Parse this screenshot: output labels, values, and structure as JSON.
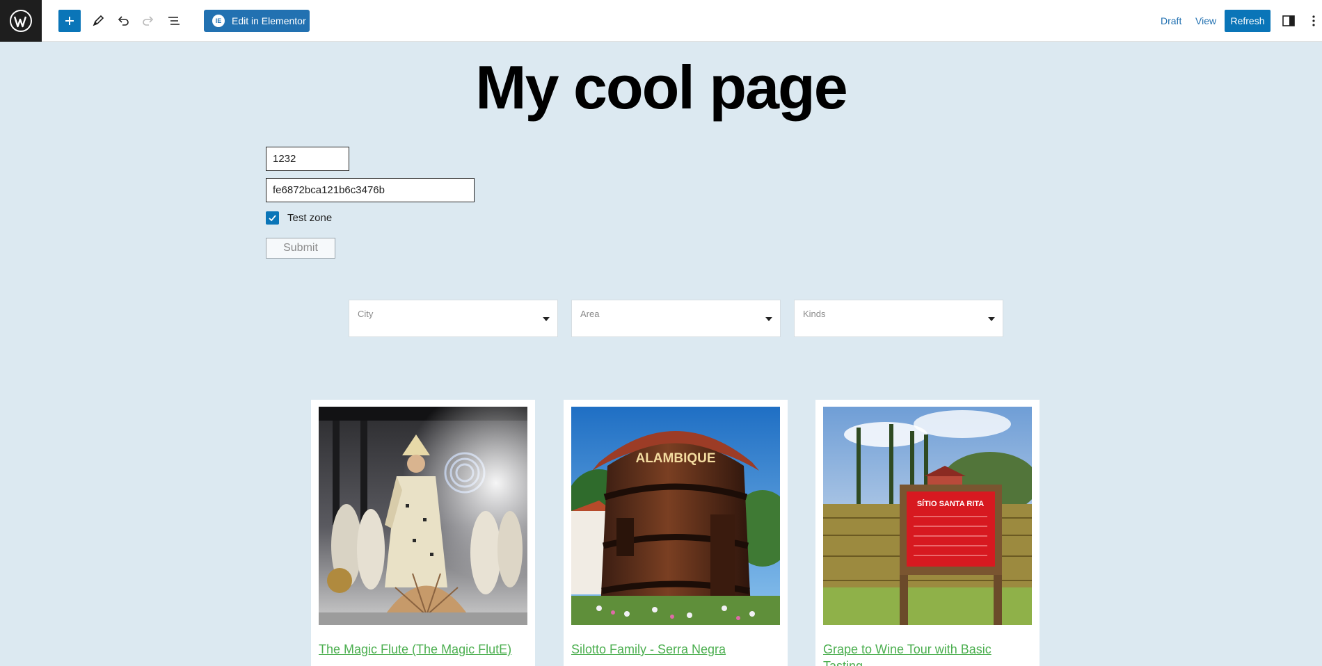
{
  "toolbar": {
    "elementor_label": "Edit in Elementor",
    "draft_label": "Draft",
    "view_label": "View",
    "refresh_label": "Refresh"
  },
  "page": {
    "title": "My cool page"
  },
  "form": {
    "id_value": "1232",
    "key_value": "fe6872bca121b6c3476b",
    "checkbox_label": "Test zone",
    "checkbox_checked": true,
    "submit_label": "Submit"
  },
  "filters": {
    "city_label": "City",
    "area_label": "Area",
    "kinds_label": "Kinds"
  },
  "cards": [
    {
      "title": "The Magic Flute (The Magic FlutE)"
    },
    {
      "title": "Silotto Family - Serra Negra",
      "sign_text": "ALAMBIQUE"
    },
    {
      "title": "Grape to Wine Tour with Basic Tasting",
      "sign_text": "SÍTIO SANTA RITA"
    }
  ],
  "colors": {
    "accent": "#0a75b8",
    "background": "#dce9f1",
    "link": "#4caf50"
  }
}
